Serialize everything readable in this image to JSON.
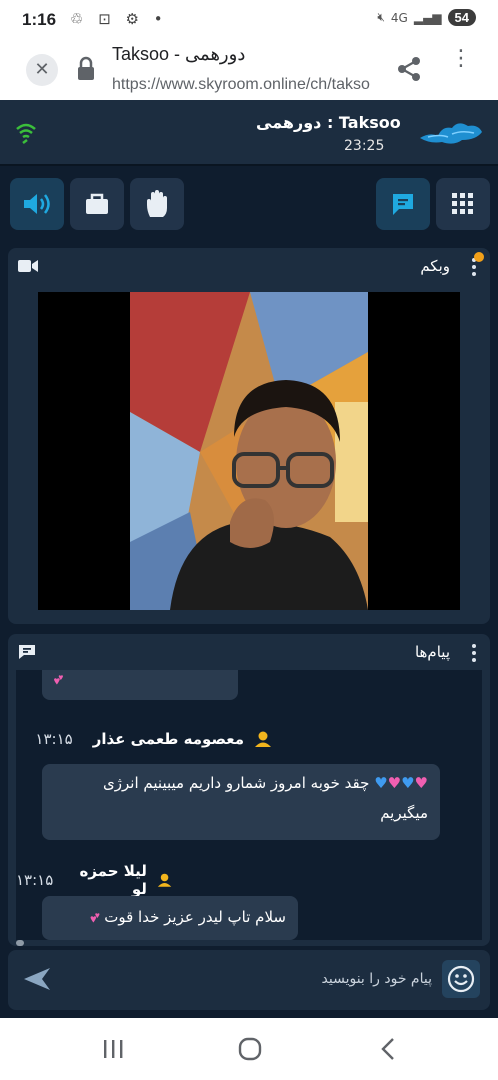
{
  "statusbar": {
    "time": "1:16",
    "battery": "54",
    "network": "4G"
  },
  "browser": {
    "page_title": "Taksoo - دورهمی",
    "url": "https://www.skyroom.online/ch/takso"
  },
  "room": {
    "title": "Taksoo : دورهمی",
    "clock": "23:25"
  },
  "webcam_panel": {
    "title": "وبکم"
  },
  "messages_panel": {
    "title": "پیام‌ها",
    "items": [
      {
        "name": "معصومه طعمی عذار",
        "time": "۱۳:۱۵",
        "text": "چقد خوبه امروز شمارو داریم میبینیم انرژی میگیریم"
      },
      {
        "name": "لیلا حمزه لو",
        "time": "۱۳:۱۵",
        "text": "سلام تاپ لیدر عزیز خدا قوت"
      }
    ]
  },
  "composer": {
    "placeholder": "پیام خود را بنویسید"
  },
  "colors": {
    "accent": "#1fa9e0",
    "panel": "#1c2d40",
    "background": "#0f1d2e",
    "bubble": "#2a3b4f",
    "notify": "#f2a019"
  }
}
